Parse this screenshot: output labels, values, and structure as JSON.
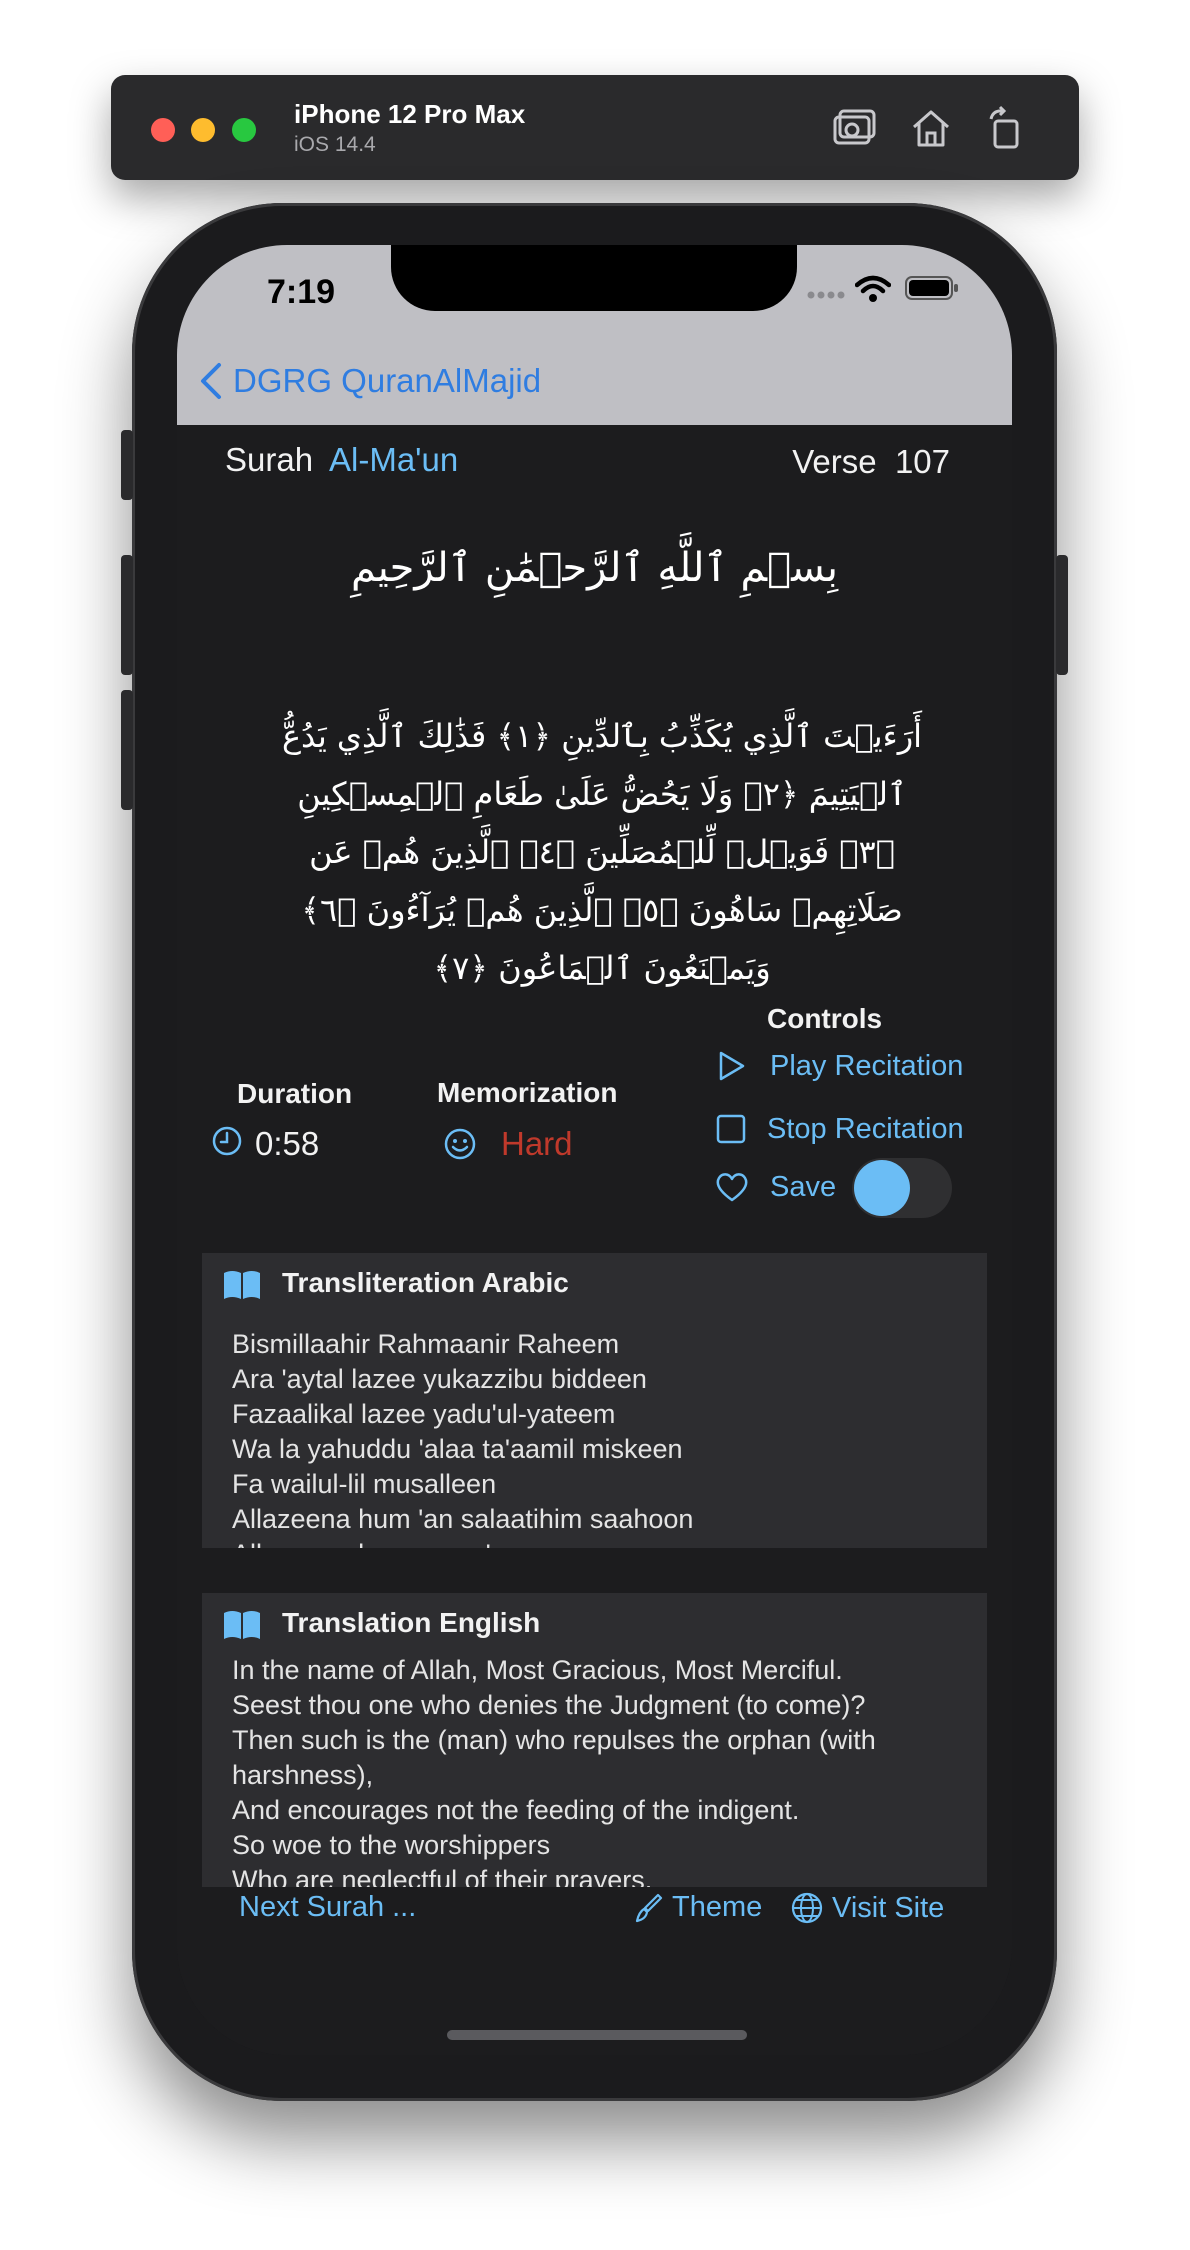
{
  "simulator": {
    "device_name": "iPhone 12 Pro Max",
    "os": "iOS 14.4"
  },
  "status": {
    "time": "7:19"
  },
  "nav": {
    "back_label": "DGRG QuranAlMajid"
  },
  "header": {
    "surah_label": "Surah",
    "surah_name": "Al-Ma'un",
    "verse_label": "Verse",
    "verse_number": "107"
  },
  "bismillah": "بِسۡمِ ٱللَّهِ ٱلرَّحۡمَٰنِ ٱلرَّحِيمِ",
  "arabic_text": "أَرَءَيۡتَ ٱلَّذِي يُكَذِّبُ بِٱلدِّينِ ﴿١﴾ فَذَٰلِكَ ٱلَّذِي يَدُعُّ ٱلۡيَتِيمَ ﴿٢﴾ وَلَا يَحُضُّ عَلَىٰ طَعَامِ ٱلۡمِسۡكِينِ ﴿٣﴾ فَوَيۡلٞ لِّلۡمُصَلِّينَ ﴿٤﴾ ٱلَّذِينَ هُمۡ عَن صَلَاتِهِمۡ سَاهُونَ ﴿٥﴾ ٱلَّذِينَ هُمۡ يُرَآءُونَ ﴿٦﴾ وَيَمۡنَعُونَ ٱلۡمَاعُونَ ﴿٧﴾",
  "duration": {
    "label": "Duration",
    "value": "0:58"
  },
  "memorization": {
    "label": "Memorization",
    "value": "Hard",
    "color": "#c0392b"
  },
  "controls": {
    "label": "Controls",
    "play": "Play Recitation",
    "stop": "Stop Recitation",
    "save": "Save",
    "save_on": true
  },
  "transliteration": {
    "title": "Transliteration Arabic",
    "lines": [
      "Bismillaahir Rahmaanir Raheem",
      "Ara 'aytal lazee yukazzibu biddeen",
      "Fazaalikal lazee yadu'ul-yateem",
      "Wa la yahuddu 'alaa ta'aamil miskeen",
      "Fa wailul-lil musalleen",
      "Allazeena hum 'an salaatihim saahoon",
      "Allazeena hum yuraa'oon"
    ]
  },
  "translation": {
    "title": "Translation English",
    "lines": [
      "In the name of Allah, Most Gracious, Most Merciful.",
      "Seest thou one who denies the Judgment (to come)?",
      "Then such is the (man) who repulses the orphan (with",
      "harshness),",
      "And encourages not the feeding of the indigent.",
      "So woe to the worshippers",
      "Who are neglectful of their prayers,"
    ]
  },
  "footer": {
    "next": "Next Surah ...",
    "theme": "Theme",
    "visit": "Visit Site"
  }
}
